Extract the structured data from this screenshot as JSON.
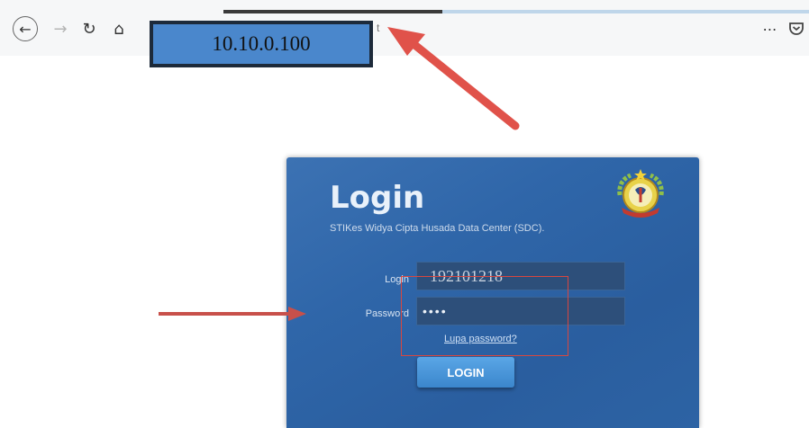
{
  "browser": {
    "url_display": "10.10.0.100",
    "url_hint_char": "t",
    "icons": [
      "back-arrow-icon",
      "forward-arrow-icon",
      "reload-icon",
      "home-icon",
      "more-icon",
      "pocket-icon"
    ],
    "loading_progress": 0.37
  },
  "login_panel": {
    "title": "Login",
    "subtitle": "STIKes Widya Cipta Husada Data Center (SDC).",
    "login_label": "Login",
    "login_value": "192101218",
    "password_label": "Password",
    "password_value": "••••",
    "forgot_link": "Lupa password?",
    "login_button": "LOGIN",
    "logo_icon": "institution-emblem-icon"
  },
  "annotations": {
    "arrow_color": "#e0524a",
    "box_color": "#d9473f"
  }
}
